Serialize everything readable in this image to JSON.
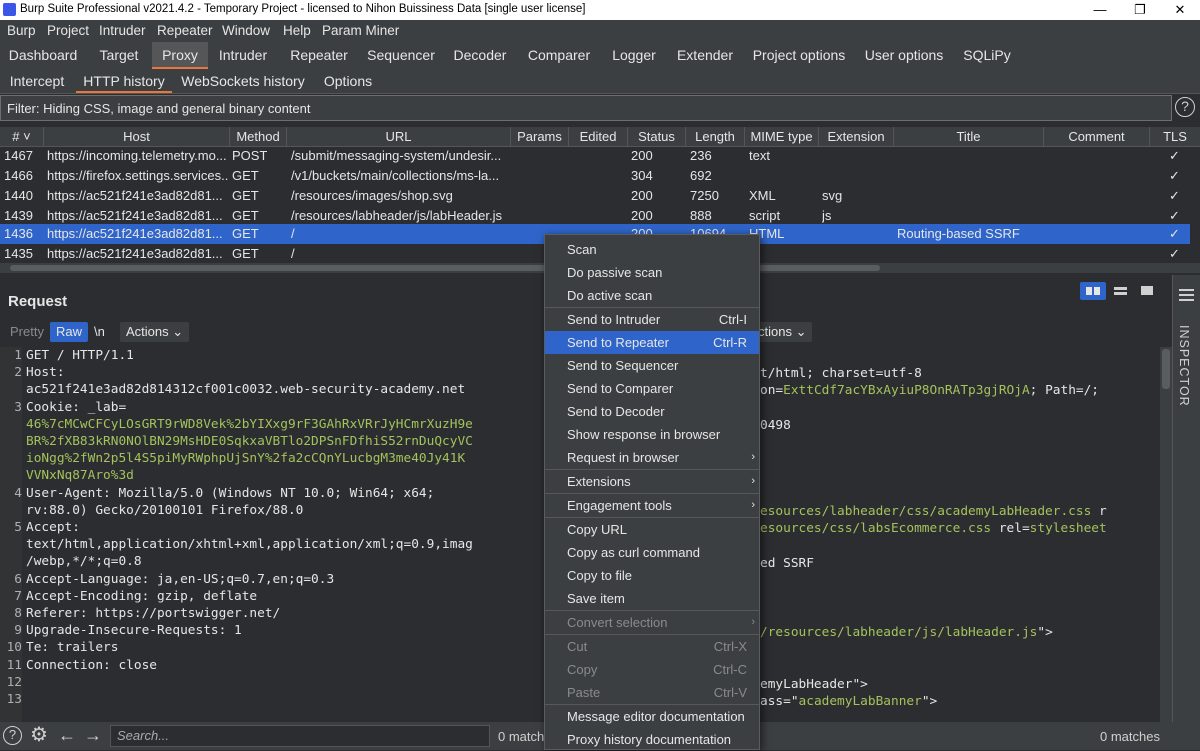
{
  "window": {
    "title": "Burp Suite Professional v2021.4.2 - Temporary Project - licensed to Nihon Buissiness Data [single user license]",
    "minimize": "—",
    "restore": "❐",
    "close": "✕"
  },
  "menu": [
    "Burp",
    "Project",
    "Intruder",
    "Repeater",
    "Window",
    "Help",
    "Param Miner"
  ],
  "main_tabs": [
    "Dashboard",
    "Target",
    "Proxy",
    "Intruder",
    "Repeater",
    "Sequencer",
    "Decoder",
    "Comparer",
    "Logger",
    "Extender",
    "Project options",
    "User options",
    "SQLiPy"
  ],
  "main_tab_selected": "Proxy",
  "sub_tabs": [
    "Intercept",
    "HTTP history",
    "WebSockets history",
    "Options"
  ],
  "sub_tab_selected": "HTTP history",
  "filter": "Filter: Hiding CSS, image and general binary content",
  "help_glyph": "?",
  "table": {
    "headers": [
      "# ˅",
      "Host",
      "Method",
      "URL",
      "Params",
      "Edited",
      "Status",
      "Length",
      "MIME type",
      "Extension",
      "Title",
      "Comment",
      "TLS"
    ],
    "rows": [
      {
        "num": "1467",
        "host": "https://incoming.telemetry.mo...",
        "method": "POST",
        "url": "/submit/messaging-system/undesir...",
        "status": "200",
        "length": "236",
        "mime": "text",
        "ext": "",
        "title": "",
        "tls": "✓"
      },
      {
        "num": "1466",
        "host": "https://firefox.settings.services...",
        "method": "GET",
        "url": "/v1/buckets/main/collections/ms-la...",
        "status": "304",
        "length": "692",
        "mime": "",
        "ext": "",
        "title": "",
        "tls": "✓"
      },
      {
        "num": "1440",
        "host": "https://ac521f241e3ad82d81...",
        "method": "GET",
        "url": "/resources/images/shop.svg",
        "status": "200",
        "length": "7250",
        "mime": "XML",
        "ext": "svg",
        "title": "",
        "tls": "✓"
      },
      {
        "num": "1439",
        "host": "https://ac521f241e3ad82d81...",
        "method": "GET",
        "url": "/resources/labheader/js/labHeader.js",
        "status": "200",
        "length": "888",
        "mime": "script",
        "ext": "js",
        "title": "",
        "tls": "✓"
      },
      {
        "num": "1436",
        "host": "https://ac521f241e3ad82d81...",
        "method": "GET",
        "url": "/",
        "status": "200",
        "length": "10694",
        "mime": "HTML",
        "ext": "",
        "title": "Routing-based SSRF",
        "tls": "✓"
      },
      {
        "num": "1435",
        "host": "https://ac521f241e3ad82d81...",
        "method": "GET",
        "url": "/",
        "status": "",
        "length": "",
        "mime": "",
        "ext": "",
        "title": "",
        "tls": "✓"
      }
    ]
  },
  "request": {
    "title": "Request",
    "buttons": {
      "pretty": "Pretty",
      "raw": "Raw",
      "newline": "\\n",
      "actions": "Actions ⌄"
    },
    "lines": [
      {
        "n": "1",
        "parts": [
          {
            "t": "GET / HTTP/1.1",
            "g": false
          }
        ]
      },
      {
        "n": "2",
        "parts": [
          {
            "t": "Host:",
            "g": false
          }
        ]
      },
      {
        "n": "",
        "parts": [
          {
            "t": "ac521f241e3ad82d814312cf001c0032.web-security-academy.net",
            "g": false
          }
        ]
      },
      {
        "n": "3",
        "parts": [
          {
            "t": "Cookie: _lab=",
            "g": false
          }
        ]
      },
      {
        "n": "",
        "parts": [
          {
            "t": "46%7cMCwCFCyLOsGRT9rWD8Vek%2bYIXxg9rF3GAhRxVRrJyHCmrXuzH9e",
            "g": true
          }
        ]
      },
      {
        "n": "",
        "parts": [
          {
            "t": "BR%2fXB83kRN0NOlBN29MsHDE0SqkxaVBTlo2DPSnFDfhiS52rnDuQcyVC",
            "g": true
          }
        ]
      },
      {
        "n": "",
        "parts": [
          {
            "t": "ioNgg%2fWn2p5l4S5piMyRWphpUjSnY%2fa2cCQnYLucbgM3me40Jy41K",
            "g": true
          }
        ]
      },
      {
        "n": "",
        "parts": [
          {
            "t": "VVNxNq87Aro%3d",
            "g": true
          }
        ]
      },
      {
        "n": "4",
        "parts": [
          {
            "t": "User-Agent: Mozilla/5.0 (Windows NT 10.0; Win64; x64;",
            "g": false
          }
        ]
      },
      {
        "n": "",
        "parts": [
          {
            "t": "rv:88.0) Gecko/20100101 Firefox/88.0",
            "g": false
          }
        ]
      },
      {
        "n": "5",
        "parts": [
          {
            "t": "Accept:",
            "g": false
          }
        ]
      },
      {
        "n": "",
        "parts": [
          {
            "t": "text/html,application/xhtml+xml,application/xml;q=0.9,imag",
            "g": false
          }
        ]
      },
      {
        "n": "",
        "parts": [
          {
            "t": "/webp,*/*;q=0.8",
            "g": false
          }
        ]
      },
      {
        "n": "6",
        "parts": [
          {
            "t": "Accept-Language: ja,en-US;q=0.7,en;q=0.3",
            "g": false
          }
        ]
      },
      {
        "n": "7",
        "parts": [
          {
            "t": "Accept-Encoding: gzip, deflate",
            "g": false
          }
        ]
      },
      {
        "n": "8",
        "parts": [
          {
            "t": "Referer: https://portswigger.net/",
            "g": false
          }
        ]
      },
      {
        "n": "9",
        "parts": [
          {
            "t": "Upgrade-Insecure-Requests: 1",
            "g": false
          }
        ]
      },
      {
        "n": "10",
        "parts": [
          {
            "t": "Te: trailers",
            "g": false
          }
        ]
      },
      {
        "n": "11",
        "parts": [
          {
            "t": "Connection: close",
            "g": false
          }
        ]
      },
      {
        "n": "12",
        "parts": [
          {
            "t": "",
            "g": false
          }
        ]
      },
      {
        "n": "13",
        "parts": [
          {
            "t": "",
            "g": false
          }
        ]
      }
    ]
  },
  "response": {
    "actions": "ctions ⌄",
    "lines": [
      {
        "parts": [
          {
            "t": "t/html; charset=utf-8",
            "g": false
          }
        ]
      },
      {
        "parts": [
          {
            "t": "on=",
            "g": false
          },
          {
            "t": "ExttCdf7acYBxAyiuP8OnRATp3gjROjA",
            "g": true
          },
          {
            "t": "; Path=/;",
            "g": false
          }
        ]
      },
      {
        "parts": [
          {
            "t": "0498",
            "g": false
          }
        ]
      },
      {
        "parts": [
          {
            "t": "esources/labheader/css/academyLabHeader.css",
            "g": true
          },
          {
            "t": " r",
            "g": false
          }
        ]
      },
      {
        "parts": [
          {
            "t": "esources/css/labsEcommerce.css",
            "g": true
          },
          {
            "t": " rel=",
            "g": false
          },
          {
            "t": "stylesheet",
            "g": true
          }
        ]
      },
      {
        "parts": [
          {
            "t": "ed SSRF",
            "g": false
          }
        ]
      },
      {
        "parts": [
          {
            "t": "/resources/labheader/js/labHeader.js",
            "g": true
          },
          {
            "t": "\">",
            "g": false
          }
        ]
      },
      {
        "parts": [
          {
            "t": "emyLabHeader\">",
            "g": false
          }
        ]
      },
      {
        "parts": [
          {
            "t": "ass=\"",
            "g": false
          },
          {
            "t": "academyLabBanner",
            "g": true
          },
          {
            "t": "\">",
            "g": false
          }
        ]
      }
    ]
  },
  "context_menu": {
    "items": [
      {
        "label": "Scan",
        "shortcut": "",
        "submenu": false,
        "disabled": false,
        "highlight": false
      },
      {
        "label": "Do passive scan",
        "shortcut": "",
        "submenu": false,
        "disabled": false,
        "highlight": false
      },
      {
        "label": "Do active scan",
        "shortcut": "",
        "submenu": false,
        "disabled": false,
        "highlight": false
      },
      {
        "sep": true
      },
      {
        "label": "Send to Intruder",
        "shortcut": "Ctrl-I",
        "submenu": false,
        "disabled": false,
        "highlight": false
      },
      {
        "label": "Send to Repeater",
        "shortcut": "Ctrl-R",
        "submenu": false,
        "disabled": false,
        "highlight": true
      },
      {
        "label": "Send to Sequencer",
        "shortcut": "",
        "submenu": false,
        "disabled": false,
        "highlight": false
      },
      {
        "label": "Send to Comparer",
        "shortcut": "",
        "submenu": false,
        "disabled": false,
        "highlight": false
      },
      {
        "label": "Send to Decoder",
        "shortcut": "",
        "submenu": false,
        "disabled": false,
        "highlight": false
      },
      {
        "label": "Show response in browser",
        "shortcut": "",
        "submenu": false,
        "disabled": false,
        "highlight": false
      },
      {
        "label": "Request in browser",
        "shortcut": "",
        "submenu": true,
        "disabled": false,
        "highlight": false
      },
      {
        "sep": true
      },
      {
        "label": "Extensions",
        "shortcut": "",
        "submenu": true,
        "disabled": false,
        "highlight": false
      },
      {
        "sep": true
      },
      {
        "label": "Engagement tools",
        "shortcut": "",
        "submenu": true,
        "disabled": false,
        "highlight": false
      },
      {
        "sep": true
      },
      {
        "label": "Copy URL",
        "shortcut": "",
        "submenu": false,
        "disabled": false,
        "highlight": false
      },
      {
        "label": "Copy as curl command",
        "shortcut": "",
        "submenu": false,
        "disabled": false,
        "highlight": false
      },
      {
        "label": "Copy to file",
        "shortcut": "",
        "submenu": false,
        "disabled": false,
        "highlight": false
      },
      {
        "label": "Save item",
        "shortcut": "",
        "submenu": false,
        "disabled": false,
        "highlight": false
      },
      {
        "sep": true
      },
      {
        "label": "Convert selection",
        "shortcut": "",
        "submenu": true,
        "disabled": true,
        "highlight": false
      },
      {
        "sep": true
      },
      {
        "label": "Cut",
        "shortcut": "Ctrl-X",
        "submenu": false,
        "disabled": true,
        "highlight": false
      },
      {
        "label": "Copy",
        "shortcut": "Ctrl-C",
        "submenu": false,
        "disabled": true,
        "highlight": false
      },
      {
        "label": "Paste",
        "shortcut": "Ctrl-V",
        "submenu": false,
        "disabled": true,
        "highlight": false
      },
      {
        "sep": true
      },
      {
        "label": "Message editor documentation",
        "shortcut": "",
        "submenu": false,
        "disabled": false,
        "highlight": false
      },
      {
        "label": "Proxy history documentation",
        "shortcut": "",
        "submenu": false,
        "disabled": false,
        "highlight": false
      }
    ]
  },
  "bottom": {
    "search_placeholder": "Search...",
    "matches_left": "0 match",
    "matches_right": "0 matches",
    "help_glyph": "?",
    "gear_glyph": "⚙",
    "back_glyph": "←",
    "forward_glyph": "→"
  },
  "inspector_label": "INSPECTOR",
  "colors": {
    "accent": "#e8773b",
    "selection": "#2f65ca",
    "green_text": "#a5c25c",
    "raw_button": "#2f65ca"
  }
}
